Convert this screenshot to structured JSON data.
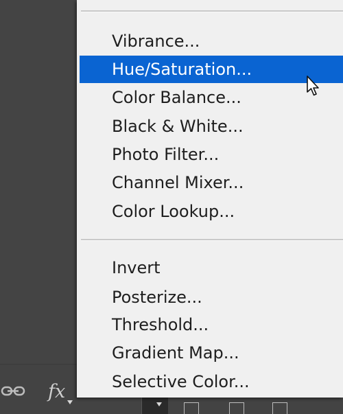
{
  "menu": {
    "group1": [
      {
        "label": "Vibrance...",
        "selected": false
      },
      {
        "label": "Hue/Saturation...",
        "selected": true
      },
      {
        "label": "Color Balance...",
        "selected": false
      },
      {
        "label": "Black & White...",
        "selected": false
      },
      {
        "label": "Photo Filter...",
        "selected": false
      },
      {
        "label": "Channel Mixer...",
        "selected": false
      },
      {
        "label": "Color Lookup...",
        "selected": false
      }
    ],
    "group2": [
      {
        "label": "Invert",
        "selected": false
      },
      {
        "label": "Posterize...",
        "selected": false
      },
      {
        "label": "Threshold...",
        "selected": false
      },
      {
        "label": "Gradient Map...",
        "selected": false
      },
      {
        "label": "Selective Color...",
        "selected": false
      }
    ]
  },
  "toolbar": {
    "fx_label": "fx",
    "icons": [
      "link-icon",
      "fx-icon",
      "adjustment-layer-icon"
    ]
  },
  "colors": {
    "highlight": "#0a64d2",
    "menu_bg": "#f0f0f0",
    "panel_bg": "#434343"
  }
}
